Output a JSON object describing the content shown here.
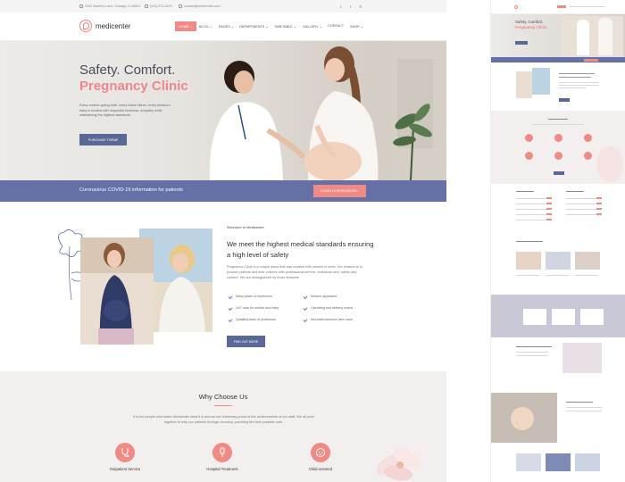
{
  "topbar": {
    "address": "1393 Marterry Lane, Chicago, IL 60601",
    "phone": "(312) 273-4215",
    "email": "contact@medicenter.com",
    "social": [
      "twitter-icon",
      "facebook-icon",
      "pinterest-icon"
    ]
  },
  "brand": {
    "name": "medicenter"
  },
  "nav": {
    "items": [
      {
        "label": "HOME",
        "active": true,
        "dropdown": true
      },
      {
        "label": "BLOG",
        "active": false,
        "dropdown": true
      },
      {
        "label": "PAGES",
        "active": false,
        "dropdown": true
      },
      {
        "label": "DEPARTMENTS",
        "active": false,
        "dropdown": true
      },
      {
        "label": "TIMETABLE",
        "active": false,
        "dropdown": true
      },
      {
        "label": "GALLERY",
        "active": false,
        "dropdown": true
      },
      {
        "label": "CONTACT",
        "active": false,
        "dropdown": false
      },
      {
        "label": "SHOP",
        "active": false,
        "dropdown": true
      }
    ]
  },
  "hero": {
    "line1": "Safety. Comfort.",
    "line2": "Pregnancy Clinic",
    "text": "Every mother giving birth, every future father, every newborn baby is treated with respectful kindness, empathy while maintaining the highest standards.",
    "button": "PURCHASE THEME"
  },
  "covid": {
    "text": "Coronavirus COVID-19 information for patients",
    "button": "COVID-19 RESOURCES"
  },
  "welcome": {
    "kicker": "Welcome to Medicenter",
    "title": "We meet the highest medical standards ensuring a high level of safety",
    "text": "Pregnancy Clinic is a unique place that was created with women in mind. Our mission is to provide patients and their children with professional service, individual care, safety and comfort. We are distinguished by those features:",
    "features": [
      "Many years of experience",
      "Modern apparatus",
      "24/7 care for mother and baby",
      "Operating and delivery rooms",
      "Qualified team of professors",
      "Neonatal intensive care room"
    ],
    "button": "FIND OUT MORE"
  },
  "why": {
    "title": "Why Choose Us",
    "text": "It is the people who make Medicenter what it is and we are extremely proud of the achievements of our staff. We all work together to help our patients through recovery, providing the best possible care.",
    "services": [
      {
        "label": "Outpatient Service",
        "icon": "stethoscope-icon"
      },
      {
        "label": "Hospital Treatment",
        "icon": "iv-drip-icon"
      },
      {
        "label": "Child-oriented",
        "icon": "baby-icon"
      }
    ]
  },
  "colors": {
    "accent": "#f08a85",
    "primary": "#5a6897",
    "covid_bar": "#6470a6"
  },
  "preview": {
    "hero_line1": "Safety. Comfort.",
    "hero_line2": "Pregnancy Clinic"
  }
}
